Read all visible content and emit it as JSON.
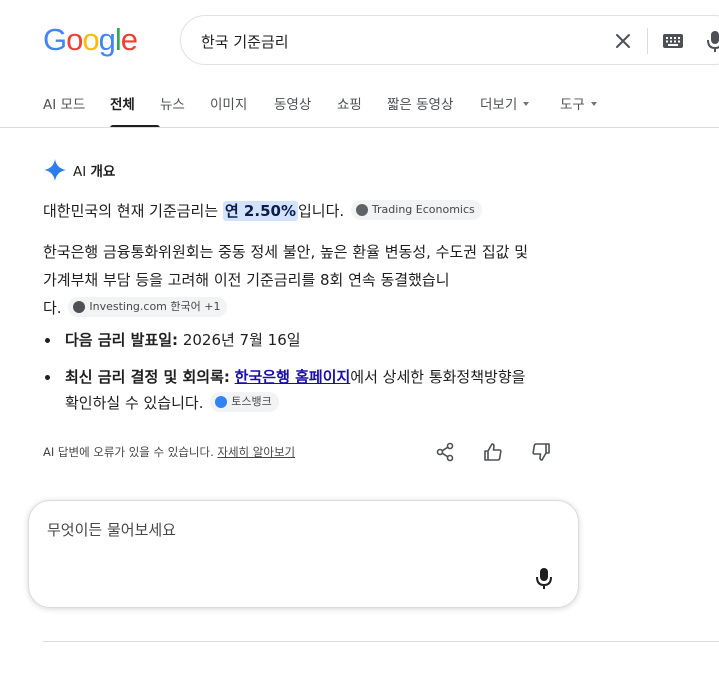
{
  "logo": {
    "letters": [
      "G",
      "o",
      "o",
      "g",
      "l",
      "e"
    ],
    "colors": [
      "#4285f4",
      "#ea4335",
      "#fbbc05",
      "#4285f4",
      "#34a853",
      "#ea4335"
    ]
  },
  "search": {
    "query": "한국 기준금리"
  },
  "tabs": [
    {
      "prefix": "AI",
      "label": "모드"
    },
    {
      "label": "전체",
      "active": true
    },
    {
      "label": "뉴스"
    },
    {
      "label": "이미지"
    },
    {
      "label": "동영상"
    },
    {
      "label": "쇼핑"
    },
    {
      "label": "짧은 동영상"
    },
    {
      "label": "더보기",
      "dropdown": true
    },
    {
      "label": "도구",
      "dropdown": true
    }
  ],
  "ai_overview": {
    "title_prefix": "AI",
    "title": "개요",
    "p1": {
      "before": "대한민국의 현재 기준금리는 ",
      "highlight": "연 2.50%",
      "after": "입니다.",
      "chip": "Trading Economics"
    },
    "p2": {
      "line1": "한국은행 금융통화위원회는 중동 정세 불안, 높은 환율 변동성, 수도권 집값 및",
      "line2": "가계부채 부담 등을 고려해 이전 기준금리를 8회 연속 동결했습니",
      "line3": "다.",
      "chip": "Investing.com 한국어 +1"
    },
    "bullets": [
      {
        "label": "다음 금리 발표일:",
        "text": " 2026년 7월 16일"
      },
      {
        "label": "최신 금리 결정 및 회의록:",
        "link": "한국은행 홈페이지",
        "text": "에서 상세한 통화정책방향을",
        "line2": "확인하실 수 있습니다.",
        "chip": "토스뱅크"
      }
    ],
    "disclaimer": "AI 답변에 오류가 있을 수 있습니다.",
    "learn_more": "자세히 알아보기"
  },
  "ask": {
    "placeholder": "무엇이든 물어보세요"
  },
  "colors": {
    "accent": "#1a73e8",
    "highlight": "#d3e3fd",
    "link": "#1a0dab"
  },
  "icons": [
    "clear-icon",
    "keyboard-icon",
    "mic-icon",
    "ai-sparkle-icon",
    "share-icon",
    "thumbs-up-icon",
    "thumbs-down-icon"
  ]
}
